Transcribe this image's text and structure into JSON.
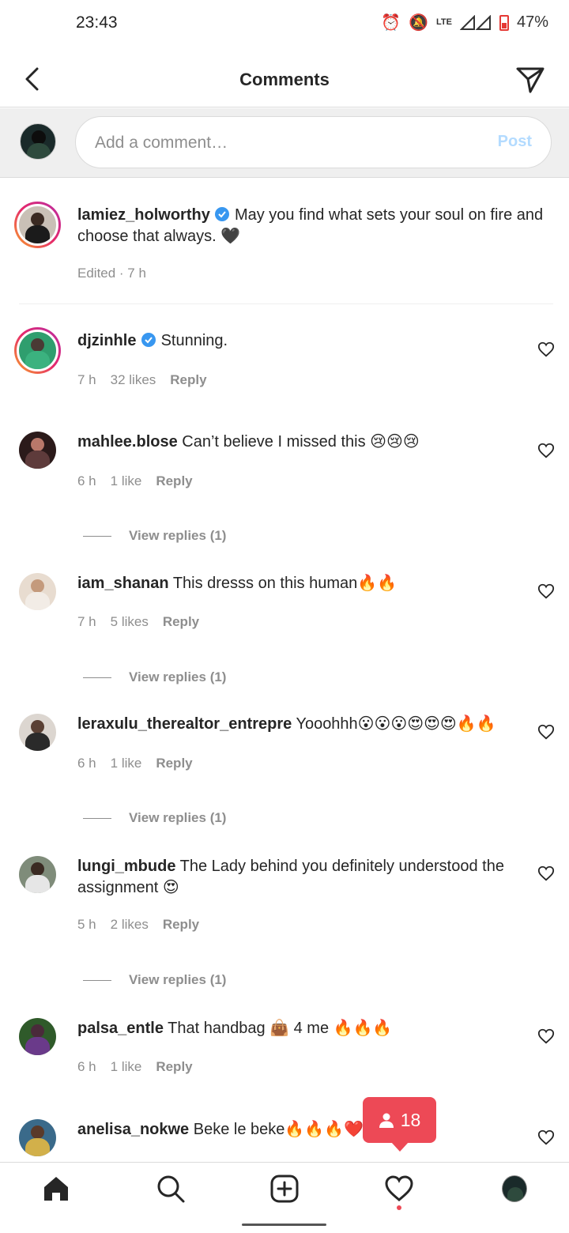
{
  "status_bar": {
    "time": "23:43",
    "network": "LTE",
    "battery": "47%"
  },
  "header": {
    "title": "Comments"
  },
  "comment_box": {
    "placeholder": "Add a comment…",
    "post_label": "Post"
  },
  "caption": {
    "username": "lamiez_holworthy",
    "verified": true,
    "text": "May you find what sets your soul on fire and choose that always. 🖤",
    "meta": "Edited · 7 h"
  },
  "comments": [
    {
      "username": "djzinhle",
      "verified": true,
      "text": "Stunning.",
      "time": "7 h",
      "likes": "32 likes",
      "reply": "Reply"
    },
    {
      "username": "mahlee.blose",
      "text": "Can’t believe I missed this 😢😢😢",
      "time": "6 h",
      "likes": "1 like",
      "reply": "Reply",
      "view_replies": "View replies (1)"
    },
    {
      "username": "iam_shanan",
      "text": "This dresss on this human🔥🔥",
      "time": "7 h",
      "likes": "5 likes",
      "reply": "Reply",
      "view_replies": "View replies (1)"
    },
    {
      "username": "leraxulu_therealtor_entrepre",
      "text": "Yooohhh😮😮😮😍😍😍🔥🔥",
      "time": "6 h",
      "likes": "1 like",
      "reply": "Reply",
      "view_replies": "View replies (1)"
    },
    {
      "username": "lungi_mbude",
      "text": "The Lady behind you definitely understood the assignment 😍",
      "time": "5 h",
      "likes": "2 likes",
      "reply": "Reply",
      "view_replies": "View replies (1)"
    },
    {
      "username": "palsa_entle",
      "text": "That handbag 👜 4 me 🔥🔥🔥",
      "time": "6 h",
      "likes": "1 like",
      "reply": "Reply"
    },
    {
      "username": "anelisa_nokwe",
      "text": "Beke le beke🔥🔥🔥❤️"
    }
  ],
  "activity_badge": {
    "count": "18"
  },
  "colors": {
    "accent": "#0095f6",
    "notification": "#ed4956",
    "verified": "#3897f0",
    "secondary_text": "#8e8e8e"
  }
}
